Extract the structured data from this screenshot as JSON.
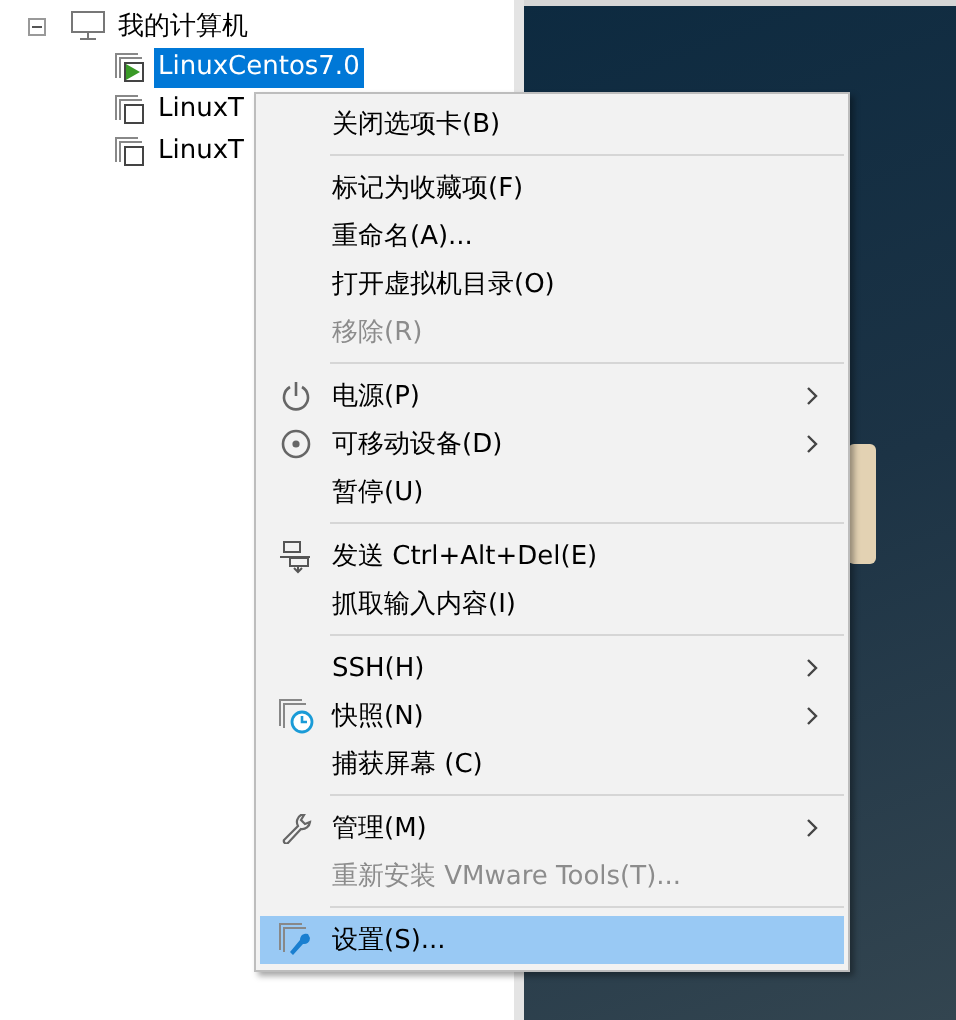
{
  "tree": {
    "label": "我的计算机",
    "expanded": true,
    "children": [
      {
        "label": "LinuxCentos7.0",
        "selected": true,
        "running": true
      },
      {
        "label": "LinuxT",
        "selected": false,
        "running": false
      },
      {
        "label": "LinuxT",
        "selected": false,
        "running": false
      }
    ]
  },
  "context_menu": [
    {
      "kind": "item",
      "label": "关闭选项卡(B)",
      "disabled": false,
      "submenu": false,
      "selected": false
    },
    {
      "kind": "separator"
    },
    {
      "kind": "item",
      "label": "标记为收藏项(F)",
      "disabled": false,
      "submenu": false,
      "selected": false
    },
    {
      "kind": "item",
      "label": "重命名(A)...",
      "disabled": false,
      "submenu": false,
      "selected": false
    },
    {
      "kind": "item",
      "label": "打开虚拟机目录(O)",
      "disabled": false,
      "submenu": false,
      "selected": false
    },
    {
      "kind": "item",
      "label": "移除(R)",
      "disabled": true,
      "submenu": false,
      "selected": false
    },
    {
      "kind": "separator"
    },
    {
      "kind": "item",
      "label": "电源(P)",
      "disabled": false,
      "submenu": true,
      "selected": false
    },
    {
      "kind": "item",
      "label": "可移动设备(D)",
      "disabled": false,
      "submenu": true,
      "selected": false
    },
    {
      "kind": "item",
      "label": "暂停(U)",
      "disabled": false,
      "submenu": false,
      "selected": false
    },
    {
      "kind": "separator"
    },
    {
      "kind": "item",
      "label": "发送 Ctrl+Alt+Del(E)",
      "disabled": false,
      "submenu": false,
      "selected": false
    },
    {
      "kind": "item",
      "label": "抓取输入内容(I)",
      "disabled": false,
      "submenu": false,
      "selected": false
    },
    {
      "kind": "separator"
    },
    {
      "kind": "item",
      "label": "SSH(H)",
      "disabled": false,
      "submenu": true,
      "selected": false
    },
    {
      "kind": "item",
      "label": "快照(N)",
      "disabled": false,
      "submenu": true,
      "selected": false
    },
    {
      "kind": "item",
      "label": "捕获屏幕 (C)",
      "disabled": false,
      "submenu": false,
      "selected": false
    },
    {
      "kind": "separator"
    },
    {
      "kind": "item",
      "label": "管理(M)",
      "disabled": false,
      "submenu": true,
      "selected": false
    },
    {
      "kind": "item",
      "label": "重新安装 VMware Tools(T)...",
      "disabled": true,
      "submenu": false,
      "selected": false
    },
    {
      "kind": "separator"
    },
    {
      "kind": "item",
      "label": "设置(S)...",
      "disabled": false,
      "submenu": false,
      "selected": true
    }
  ]
}
